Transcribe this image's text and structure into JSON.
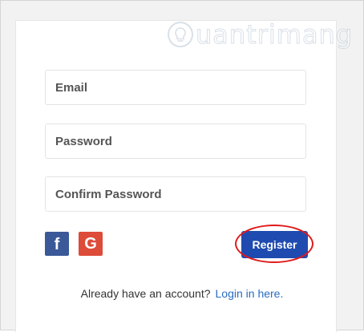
{
  "watermark": {
    "text": "uantrimang"
  },
  "form": {
    "email_placeholder": "Email",
    "password_placeholder": "Password",
    "confirm_placeholder": "Confirm Password",
    "register_label": "Register"
  },
  "social": {
    "facebook_glyph": "f",
    "google_glyph": "G"
  },
  "footer": {
    "prompt": "Already have an account?",
    "login_link": "Login in here."
  },
  "colors": {
    "primary": "#1f4bb0",
    "facebook": "#3b5998",
    "google": "#dd4b39",
    "link": "#2a6bc1",
    "highlight": "#e11a1a"
  }
}
